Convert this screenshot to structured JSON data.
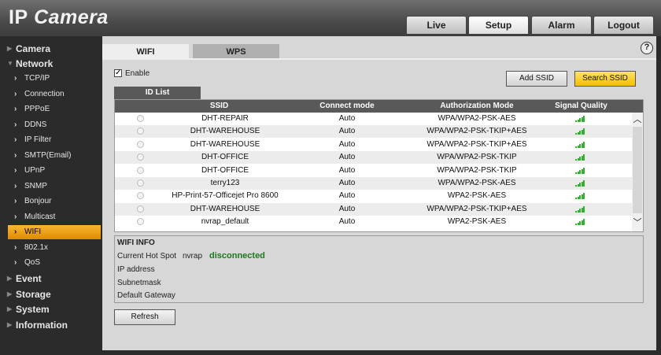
{
  "header": {
    "logo_ip": "IP",
    "logo_camera": "Camera",
    "tabs": [
      {
        "label": "Live"
      },
      {
        "label": "Setup"
      },
      {
        "label": "Alarm"
      },
      {
        "label": "Logout"
      }
    ]
  },
  "sidebar": {
    "items": [
      {
        "label": "Camera"
      },
      {
        "label": "Network"
      },
      {
        "label": "TCP/IP"
      },
      {
        "label": "Connection"
      },
      {
        "label": "PPPoE"
      },
      {
        "label": "DDNS"
      },
      {
        "label": "IP Filter"
      },
      {
        "label": "SMTP(Email)"
      },
      {
        "label": "UPnP"
      },
      {
        "label": "SNMP"
      },
      {
        "label": "Bonjour"
      },
      {
        "label": "Multicast"
      },
      {
        "label": "WIFI"
      },
      {
        "label": "802.1x"
      },
      {
        "label": "QoS"
      },
      {
        "label": "Event"
      },
      {
        "label": "Storage"
      },
      {
        "label": "System"
      },
      {
        "label": "Information"
      }
    ]
  },
  "main": {
    "help": "?",
    "subtabs": [
      {
        "label": "WIFI"
      },
      {
        "label": "WPS"
      }
    ],
    "enable_label": "Enable",
    "add_ssid": "Add SSID",
    "search_ssid": "Search SSID",
    "id_list": "ID List",
    "columns": {
      "ssid": "SSID",
      "mode": "Connect mode",
      "auth": "Authorization Mode",
      "signal": "Signal Quality"
    },
    "rows": [
      {
        "ssid": "DHT-REPAIR",
        "mode": "Auto",
        "auth": "WPA/WPA2-PSK-AES"
      },
      {
        "ssid": "DHT-WAREHOUSE",
        "mode": "Auto",
        "auth": "WPA/WPA2-PSK-TKIP+AES"
      },
      {
        "ssid": "DHT-WAREHOUSE",
        "mode": "Auto",
        "auth": "WPA/WPA2-PSK-TKIP+AES"
      },
      {
        "ssid": "DHT-OFFICE",
        "mode": "Auto",
        "auth": "WPA/WPA2-PSK-TKIP"
      },
      {
        "ssid": "DHT-OFFICE",
        "mode": "Auto",
        "auth": "WPA/WPA2-PSK-TKIP"
      },
      {
        "ssid": "terry123",
        "mode": "Auto",
        "auth": "WPA/WPA2-PSK-AES"
      },
      {
        "ssid": "HP-Print-57-Officejet Pro 8600",
        "mode": "Auto",
        "auth": "WPA2-PSK-AES"
      },
      {
        "ssid": "DHT-WAREHOUSE",
        "mode": "Auto",
        "auth": "WPA/WPA2-PSK-TKIP+AES"
      },
      {
        "ssid": "nvrap_default",
        "mode": "Auto",
        "auth": "WPA2-PSK-AES"
      }
    ],
    "wifi_info": {
      "title": "WIFI INFO",
      "hotspot_label": "Current Hot Spot",
      "hotspot_name": "nvrap",
      "hotspot_status": "disconnected",
      "ip_label": "IP address",
      "subnet_label": "Subnetmask",
      "gateway_label": "Default Gateway"
    },
    "refresh": "Refresh"
  },
  "colors": {
    "accent": "#f5c000",
    "active_nav": "#e08b00",
    "signal": "#2fb32f",
    "status_text": "#1b7a1b",
    "highlight": "#d40000"
  }
}
